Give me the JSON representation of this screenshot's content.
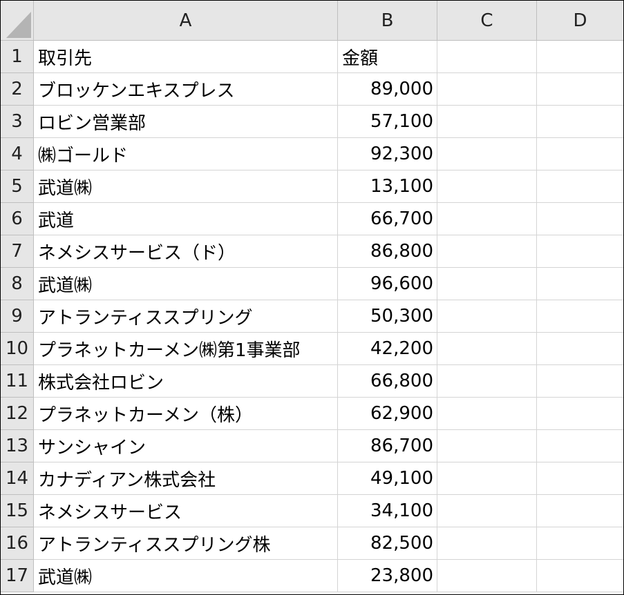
{
  "spreadsheet": {
    "columns": [
      "A",
      "B",
      "C",
      "D"
    ],
    "rows": [
      {
        "num": "1",
        "a": "取引先",
        "b": "金額"
      },
      {
        "num": "2",
        "a": "ブロッケンエキスプレス",
        "b": "89,000"
      },
      {
        "num": "3",
        "a": "ロビン営業部",
        "b": "57,100"
      },
      {
        "num": "4",
        "a": "㈱ゴールド",
        "b": "92,300"
      },
      {
        "num": "5",
        "a": "武道㈱",
        "b": "13,100"
      },
      {
        "num": "6",
        "a": "武道",
        "b": "66,700"
      },
      {
        "num": "7",
        "a": "ネメシスサービス（ド）",
        "b": "86,800"
      },
      {
        "num": "8",
        "a": "武道㈱",
        "b": "96,600"
      },
      {
        "num": "9",
        "a": "アトランティススプリング",
        "b": "50,300"
      },
      {
        "num": "10",
        "a": "プラネットカーメン㈱第1事業部",
        "b": "42,200"
      },
      {
        "num": "11",
        "a": "株式会社ロビン",
        "b": "66,800"
      },
      {
        "num": "12",
        "a": "プラネットカーメン（株）",
        "b": "62,900"
      },
      {
        "num": "13",
        "a": "サンシャイン",
        "b": "86,700"
      },
      {
        "num": "14",
        "a": "カナディアン株式会社",
        "b": "49,100"
      },
      {
        "num": "15",
        "a": "ネメシスサービス",
        "b": "34,100"
      },
      {
        "num": "16",
        "a": "アトランティススプリング株",
        "b": "82,500"
      },
      {
        "num": "17",
        "a": "武道㈱",
        "b": "23,800"
      }
    ]
  },
  "colors": {
    "header_bg": "#e6e6e6",
    "grid_line": "#d4d4d4",
    "corner_triangle": "#b4b4b4"
  },
  "icons": {
    "select_all": "select-all-triangle-icon"
  }
}
